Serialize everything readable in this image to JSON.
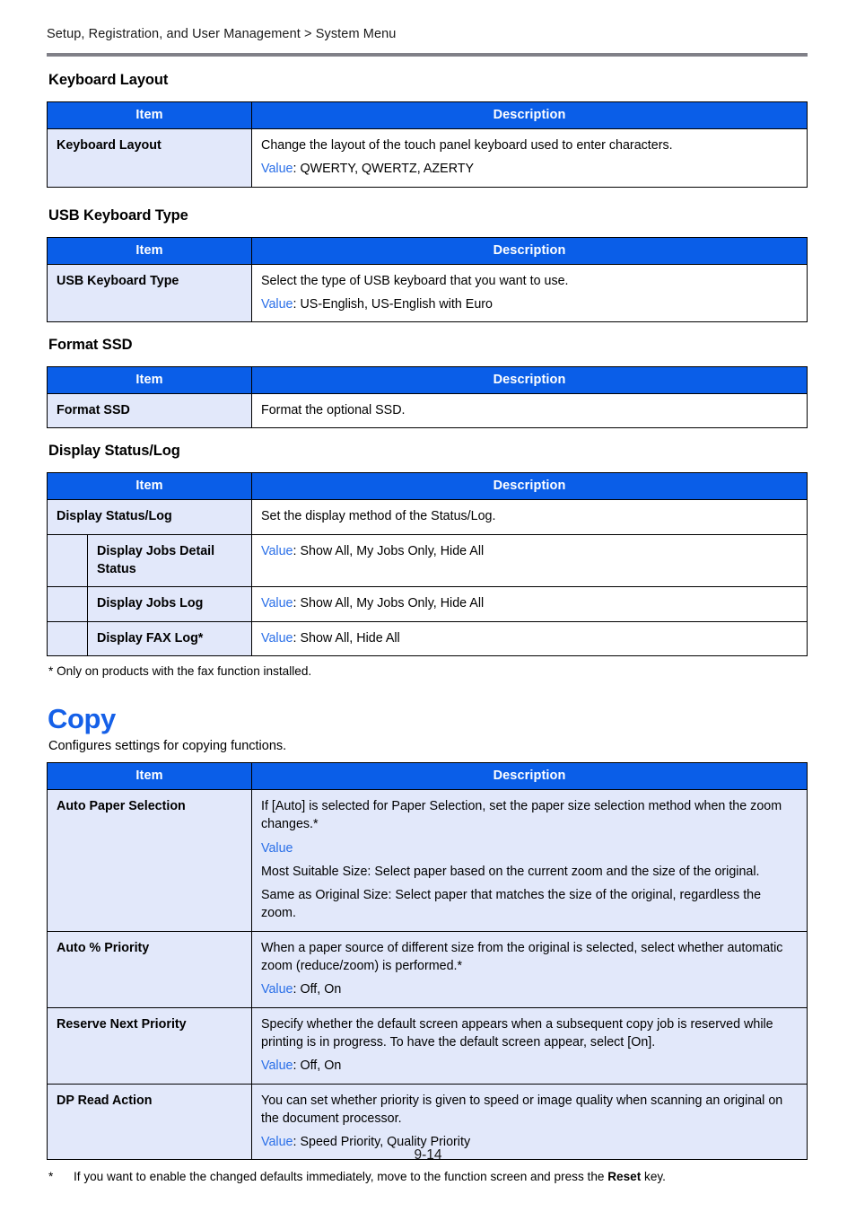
{
  "breadcrumb": "Setup, Registration, and User Management > System Menu",
  "colors": {
    "table_header_blue": "#0a5ee8",
    "row_tint": "#e2e8fa",
    "value_label_blue": "#2a6fe8",
    "heading_blue": "#1560e8",
    "rule_gray": "#808088"
  },
  "table_headers": {
    "item": "Item",
    "description": "Description"
  },
  "sections": [
    {
      "title": "Keyboard Layout",
      "rows": [
        {
          "item": "Keyboard Layout",
          "desc_line1": "Change the layout of the touch panel keyboard used to enter characters.",
          "value_label": "Value",
          "value_text": ": QWERTY, QWERTZ, AZERTY"
        }
      ]
    },
    {
      "title": "USB Keyboard Type",
      "rows": [
        {
          "item": "USB Keyboard Type",
          "desc_line1": "Select the type of USB keyboard that you want to use.",
          "value_label": "Value",
          "value_text": ": US-English, US-English with Euro"
        }
      ]
    },
    {
      "title": "Format SSD",
      "rows": [
        {
          "item": "Format SSD",
          "desc_line1": "Format the optional SSD."
        }
      ]
    }
  ],
  "display_status_log": {
    "title": "Display Status/Log",
    "parent_row": {
      "item": "Display Status/Log",
      "desc": "Set the display method of the Status/Log."
    },
    "sub_rows": [
      {
        "item": "Display Jobs Detail Status",
        "value_label": "Value",
        "value_text": ": Show All, My Jobs Only, Hide All"
      },
      {
        "item": "Display Jobs Log",
        "value_label": "Value",
        "value_text": ": Show All, My Jobs Only, Hide All"
      },
      {
        "item": "Display FAX Log*",
        "value_label": "Value",
        "value_text": ": Show All, Hide All"
      }
    ],
    "footnote": "* Only on products with the fax function installed."
  },
  "copy": {
    "heading": "Copy",
    "intro": "Configures settings for copying functions.",
    "rows": [
      {
        "item": "Auto Paper Selection",
        "desc_line1": "If [Auto] is selected for Paper Selection, set the paper size selection method when the zoom changes.*",
        "value_label": "Value",
        "value_text": "",
        "extra_line1": "Most Suitable Size: Select paper based on the current zoom and the size of the original.",
        "extra_line2": "Same as Original Size: Select paper that matches the size of the original, regardless the zoom."
      },
      {
        "item": "Auto % Priority",
        "desc_line1": "When a paper source of different size from the original is selected, select whether automatic zoom (reduce/zoom) is performed.*",
        "value_label": "Value",
        "value_text": ": Off, On"
      },
      {
        "item": "Reserve Next Priority",
        "desc_line1": "Specify whether the default screen appears when a subsequent copy job is reserved while printing is in progress. To have the default screen appear, select [On].",
        "value_label": "Value",
        "value_text": ": Off, On"
      },
      {
        "item": "DP Read Action",
        "desc_line1": "You can set whether priority is given to speed or image quality when scanning an original on the document processor.",
        "value_label": "Value",
        "value_text": ": Speed Priority, Quality Priority"
      }
    ],
    "footnote": {
      "star": "*",
      "text_before": "If you want to enable the changed defaults immediately, move to the function screen and press the ",
      "bold_word": "Reset",
      "text_after": " key."
    }
  },
  "page_number": "9-14"
}
